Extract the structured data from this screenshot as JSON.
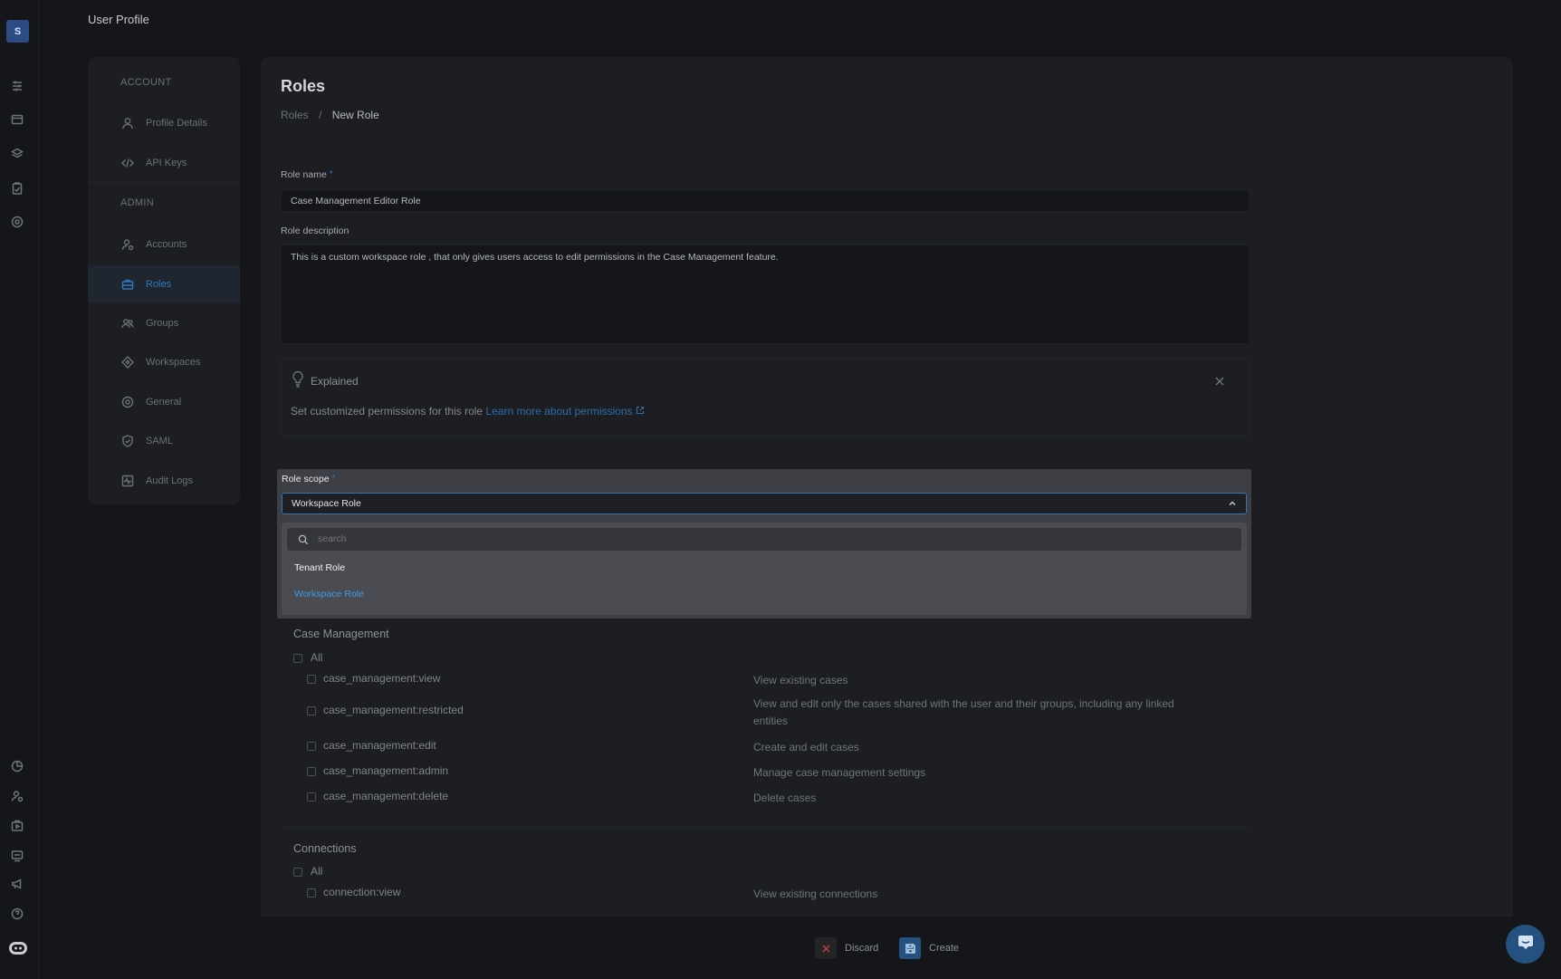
{
  "app": {
    "logo_letter": "S",
    "page_title": "User Profile"
  },
  "rail": {
    "top_icons": [
      "sliders-icon",
      "window-icon",
      "layers-icon",
      "clipboard-icon",
      "target-icon"
    ],
    "bottom_icons": [
      "chart-icon",
      "user-settings-icon",
      "media-icon",
      "device-icon",
      "megaphone-icon",
      "help-icon",
      "bot-icon"
    ]
  },
  "nav": {
    "account_heading": "ACCOUNT",
    "admin_heading": "ADMIN",
    "items": [
      {
        "label": "Profile Details",
        "icon": "user-icon"
      },
      {
        "label": "API Keys",
        "icon": "code-icon"
      },
      {
        "label": "Accounts",
        "icon": "user-settings-icon"
      },
      {
        "label": "Roles",
        "icon": "briefcase-icon",
        "active": true
      },
      {
        "label": "Groups",
        "icon": "users-icon"
      },
      {
        "label": "Workspaces",
        "icon": "diamond-icon"
      },
      {
        "label": "General",
        "icon": "gear-icon"
      },
      {
        "label": "SAML",
        "icon": "shield-icon"
      },
      {
        "label": "Audit Logs",
        "icon": "activity-icon"
      }
    ]
  },
  "main": {
    "title": "Roles",
    "breadcrumb": {
      "parent": "Roles",
      "separator": "/",
      "current": "New Role"
    },
    "role_name": {
      "label": "Role name",
      "required": "*",
      "value": "Case Management Editor Role"
    },
    "role_description": {
      "label": "Role description",
      "value": "This is a custom workspace role , that only gives users access to edit permissions in the Case Management feature."
    },
    "explained": {
      "title": "Explained",
      "text": "Set customized permissions for this role",
      "link": "Learn more about permissions"
    },
    "role_scope": {
      "label": "Role scope",
      "required": "*",
      "selected": "Workspace Role",
      "search_placeholder": "search",
      "options": [
        "Tenant Role",
        "Workspace Role"
      ]
    },
    "permission_groups": [
      {
        "title": "Case Management",
        "all_label": "All",
        "permissions": [
          {
            "name": "case_management:view",
            "desc": "View existing cases"
          },
          {
            "name": "case_management:restricted",
            "desc": "View and edit only the cases shared with the user and their groups, including any linked entities"
          },
          {
            "name": "case_management:edit",
            "desc": "Create and edit cases"
          },
          {
            "name": "case_management:admin",
            "desc": "Manage case management settings"
          },
          {
            "name": "case_management:delete",
            "desc": "Delete cases"
          }
        ]
      },
      {
        "title": "Connections",
        "all_label": "All",
        "permissions": [
          {
            "name": "connection:view",
            "desc": "View existing connections"
          }
        ]
      }
    ]
  },
  "actions": {
    "discard": "Discard",
    "create": "Create"
  },
  "colors": {
    "accent": "#2f77bd",
    "link": "#3c9be8",
    "danger": "#b03d3d",
    "background": "#141619",
    "panel": "#1c1e22"
  }
}
